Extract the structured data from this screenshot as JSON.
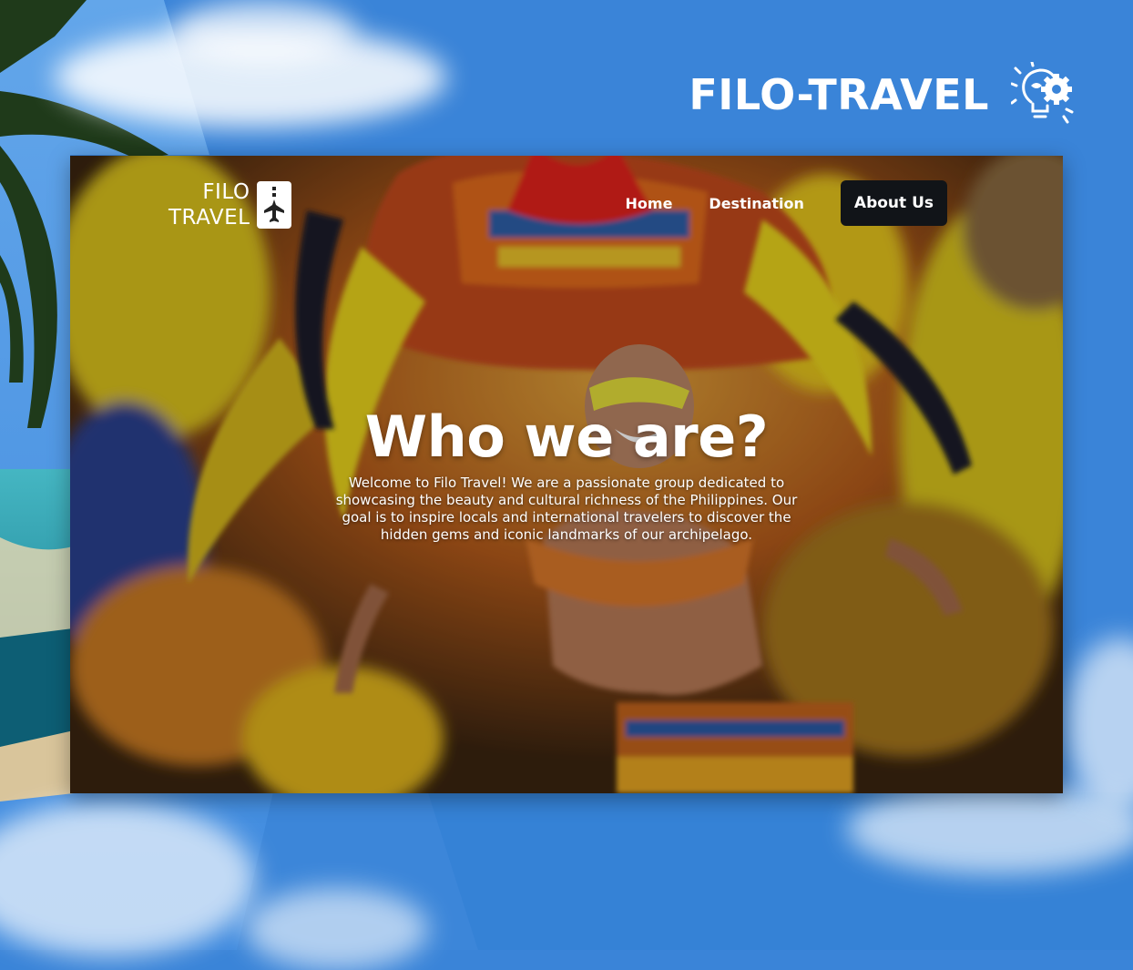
{
  "brand": {
    "title": "FILO-TRAVEL",
    "icon": "lightbulb-gear-icon",
    "accent_color": "#3a84d8"
  },
  "site": {
    "logo_line1": "FILO",
    "logo_line2": "TRAVEL",
    "logo_icon": "airplane-icon",
    "nav": {
      "home": "Home",
      "destination": "Destination",
      "about": "About Us"
    },
    "hero": {
      "title": "Who we are?",
      "body": "Welcome to Filo Travel! We are a passionate group dedicated to showcasing the beauty and cultural richness of the Philippines. Our goal is to inspire locals and international travelers to discover the hidden gems and iconic landmarks of our archipelago."
    }
  }
}
